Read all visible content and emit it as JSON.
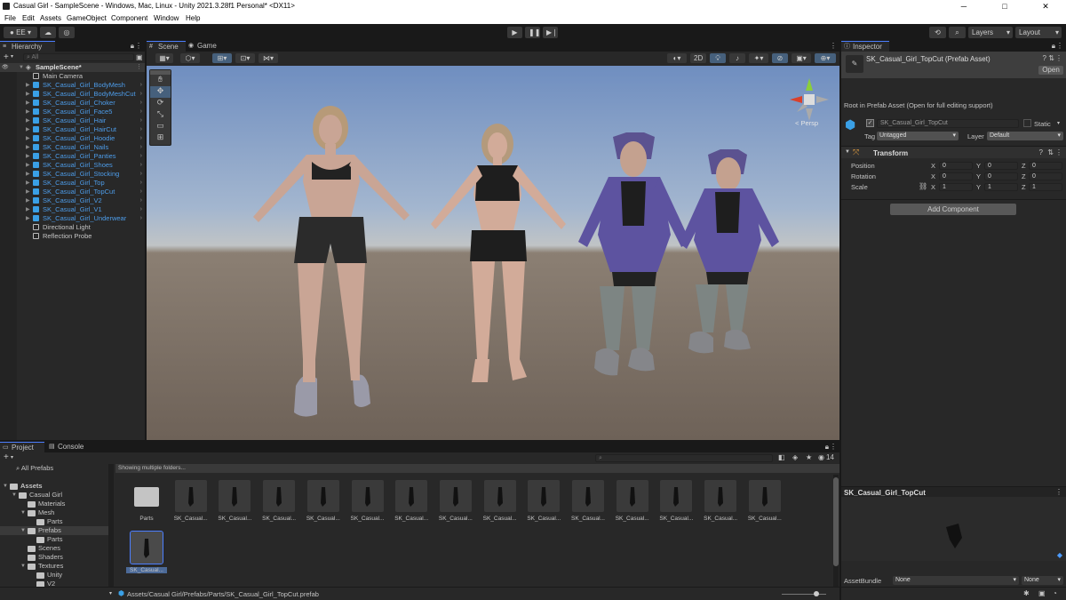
{
  "window": {
    "title": "Casual Girl - SampleScene - Windows, Mac, Linux - Unity 2021.3.28f1 Personal* <DX11>",
    "min": "─",
    "max": "□",
    "close": "✕"
  },
  "menu": [
    "File",
    "Edit",
    "Assets",
    "GameObject",
    "Component",
    "Window",
    "Help"
  ],
  "toolbar": {
    "account": "EE",
    "layers": "Layers",
    "layout": "Layout"
  },
  "hierarchy": {
    "tab": "Hierarchy",
    "search_placeholder": "All",
    "scene": "SampleScene*",
    "items": [
      {
        "label": "Main Camera",
        "prefab": false,
        "expand": false
      },
      {
        "label": "SK_Casual_Girl_BodyMesh",
        "prefab": true,
        "expand": true
      },
      {
        "label": "SK_Casual_Girl_BodyMeshCut",
        "prefab": true,
        "expand": true
      },
      {
        "label": "SK_Casual_Girl_Choker",
        "prefab": true,
        "expand": true
      },
      {
        "label": "SK_Casual_Girl_Face5",
        "prefab": true,
        "expand": true
      },
      {
        "label": "SK_Casual_Girl_Hair",
        "prefab": true,
        "expand": true
      },
      {
        "label": "SK_Casual_Girl_HairCut",
        "prefab": true,
        "expand": true
      },
      {
        "label": "SK_Casual_Girl_Hoodie",
        "prefab": true,
        "expand": true
      },
      {
        "label": "SK_Casual_Girl_Nails",
        "prefab": true,
        "expand": true
      },
      {
        "label": "SK_Casual_Girl_Panties",
        "prefab": true,
        "expand": true
      },
      {
        "label": "SK_Casual_Girl_Shoes",
        "prefab": true,
        "expand": true
      },
      {
        "label": "SK_Casual_Girl_Stocking",
        "prefab": true,
        "expand": true
      },
      {
        "label": "SK_Casual_Girl_Top",
        "prefab": true,
        "expand": true
      },
      {
        "label": "SK_Casual_Girl_TopCut",
        "prefab": true,
        "expand": true
      },
      {
        "label": "SK_Casual_Girl_V2",
        "prefab": true,
        "expand": true
      },
      {
        "label": "SK_Casual_Girl_V1",
        "prefab": true,
        "expand": true
      },
      {
        "label": "SK_Casual_Girl_Underwear",
        "prefab": true,
        "expand": true
      },
      {
        "label": "Directional Light",
        "prefab": false,
        "expand": false
      },
      {
        "label": "Reflection Probe",
        "prefab": false,
        "expand": false
      }
    ]
  },
  "scene": {
    "tab_scene": "Scene",
    "tab_game": "Game",
    "mode_2d": "2D",
    "persp": "Persp"
  },
  "inspector": {
    "tab": "Inspector",
    "asset_title": "SK_Casual_Girl_TopCut (Prefab Asset)",
    "open": "Open",
    "root_note": "Root in Prefab Asset (Open for full editing support)",
    "name": "SK_Casual_Girl_TopCut",
    "static": "Static",
    "tag_label": "Tag",
    "tag": "Untagged",
    "layer_label": "Layer",
    "layer": "Default",
    "transform": "Transform",
    "position": "Position",
    "rotation": "Rotation",
    "scale": "Scale",
    "x": "X",
    "y": "Y",
    "z": "Z",
    "pos": [
      "0",
      "0",
      "0"
    ],
    "rot": [
      "0",
      "0",
      "0"
    ],
    "scl": [
      "1",
      "1",
      "1"
    ],
    "add_component": "Add Component",
    "preview_title": "SK_Casual_Girl_TopCut",
    "assetbundle_label": "AssetBundle",
    "assetbundle": "None",
    "variant": "None"
  },
  "project": {
    "tab_project": "Project",
    "tab_console": "Console",
    "all_prefabs": "All Prefabs",
    "showing": "Showing multiple folders...",
    "count": "14",
    "tree": [
      {
        "label": "Assets",
        "indent": 0,
        "arrow": "▼"
      },
      {
        "label": "Casual Girl",
        "indent": 1,
        "arrow": "▼"
      },
      {
        "label": "Materials",
        "indent": 2,
        "arrow": ""
      },
      {
        "label": "Mesh",
        "indent": 2,
        "arrow": "▼"
      },
      {
        "label": "Parts",
        "indent": 3,
        "arrow": ""
      },
      {
        "label": "Prefabs",
        "indent": 2,
        "arrow": "▼"
      },
      {
        "label": "Parts",
        "indent": 3,
        "arrow": ""
      },
      {
        "label": "Scenes",
        "indent": 2,
        "arrow": ""
      },
      {
        "label": "Shaders",
        "indent": 2,
        "arrow": ""
      },
      {
        "label": "Textures",
        "indent": 2,
        "arrow": "▼"
      },
      {
        "label": "Unity",
        "indent": 3,
        "arrow": ""
      },
      {
        "label": "V2",
        "indent": 3,
        "arrow": ""
      }
    ],
    "assets": [
      "Parts",
      "SK_Casual...",
      "SK_Casual...",
      "SK_Casual...",
      "SK_Casual...",
      "SK_Casual...",
      "SK_Casual...",
      "SK_Casual...",
      "SK_Casual...",
      "SK_Casual...",
      "SK_Casual...",
      "SK_Casual...",
      "SK_Casual...",
      "SK_Casual...",
      "SK_Casual...",
      "SK_Casual..."
    ],
    "path": "Assets/Casual Girl/Prefabs/Parts/SK_Casual_Girl_TopCut.prefab"
  },
  "colors": {
    "accent": "#4c7eff",
    "prefab_blue": "#4d9ce9",
    "panel": "#282828",
    "sky_top": "#6f8ec0",
    "ground": "#6e6258"
  }
}
